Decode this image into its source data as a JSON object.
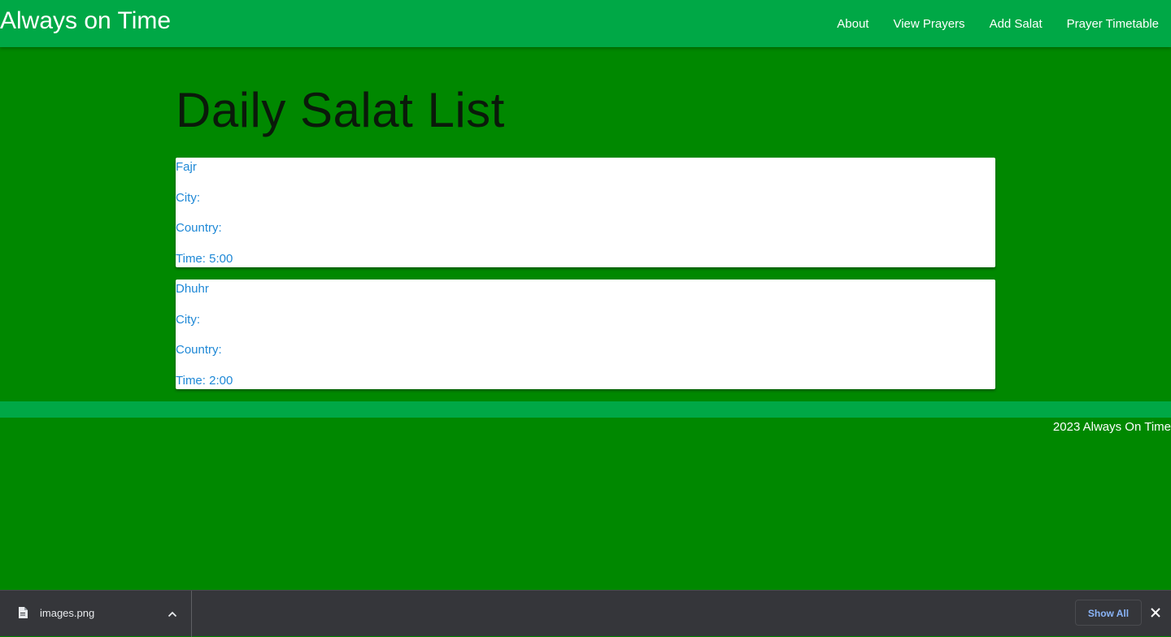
{
  "navbar": {
    "brand": "Always on Time",
    "links": [
      "About",
      "View Prayers",
      "Add Salat",
      "Prayer Timetable"
    ]
  },
  "main": {
    "title": "Daily Salat List",
    "prayers": [
      {
        "name": "Fajr",
        "city": "City:",
        "country": "Country:",
        "time": "Time: 5:00"
      },
      {
        "name": "Dhuhr",
        "city": "City:",
        "country": "Country:",
        "time": "Time: 2:00"
      }
    ]
  },
  "footer": {
    "text": "2023 Always On Time"
  },
  "download_shelf": {
    "file_name": "images.png",
    "file_icon": "file-icon",
    "show_all": "Show All",
    "close_icon": "close-icon"
  },
  "colors": {
    "page_bg": "#008800",
    "navbar_bg": "#00a846",
    "card_text": "#1e88d6",
    "shelf_bg": "#35363a",
    "show_all_text": "#8ab4f8"
  }
}
